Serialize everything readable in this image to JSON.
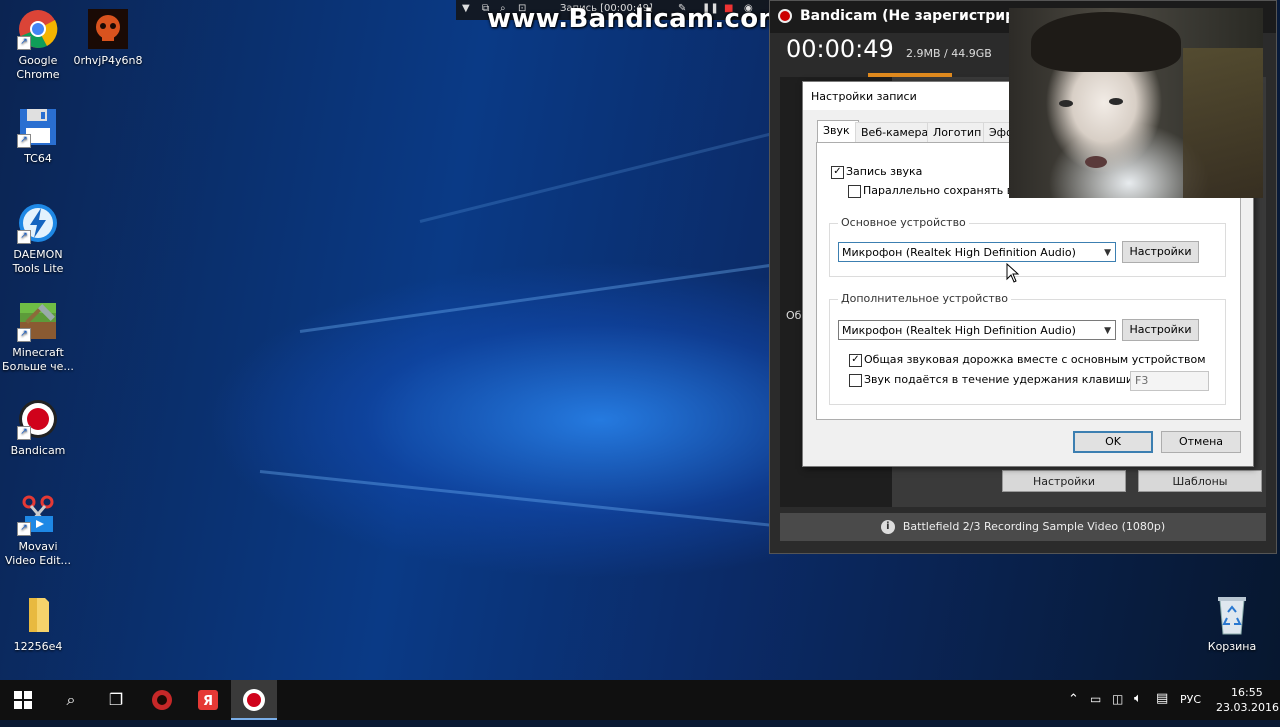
{
  "desktop": {
    "icons": [
      {
        "label": "Google\nChrome",
        "icon": "chrome-icon"
      },
      {
        "label": "0rhvjP4y6n8",
        "icon": "skull-icon"
      },
      {
        "label": "TC64",
        "icon": "floppy-icon"
      },
      {
        "label": "DAEMON\nTools Lite",
        "icon": "lightning-icon"
      },
      {
        "label": "Minecraft\nБольше че...",
        "icon": "minecraft-icon"
      },
      {
        "label": "Bandicam",
        "icon": "record-icon"
      },
      {
        "label": "Movavi\nVideo Edit...",
        "icon": "scissors-icon"
      },
      {
        "label": "12256e4",
        "icon": "folder-icon"
      },
      {
        "label": "Корзина",
        "icon": "recycle-bin-icon"
      }
    ]
  },
  "recording_bar": {
    "text": "Запись [00:00:49]"
  },
  "watermark": "www.Bandicam.com",
  "bandicam": {
    "title": "Bandicam (Не зарегистрир",
    "timer": "00:00:49",
    "size": "2.9MB / 44.9GB",
    "side_label": "Об",
    "settings_button": "Настройки",
    "templates_button": "Шаблоны",
    "footer": "Battlefield 2/3 Recording Sample Video (1080p)"
  },
  "dialog": {
    "title": "Настройки записи",
    "tabs": [
      "Звук",
      "Веб-камера",
      "Логотип",
      "Эфф"
    ],
    "record_audio": {
      "label": "Запись звука",
      "checked": true
    },
    "save_parallel": {
      "label": "Параллельно сохранять в н",
      "checked": false
    },
    "primary_group": {
      "title": "Основное устройство",
      "device": "Микрофон (Realtek High Definition Audio)",
      "settings_button": "Настройки"
    },
    "secondary_group": {
      "title": "Дополнительное устройство",
      "device": "Микрофон (Realtek High Definition Audio)",
      "settings_button": "Настройки",
      "mix_track": {
        "label": "Общая звуковая дорожка вместе с основным устройством",
        "checked": true
      },
      "hold_key": {
        "label": "Звук подаётся в течение удержания клавиши",
        "checked": false
      },
      "hotkey": "F3"
    },
    "ok_button": "OK",
    "cancel_button": "Отмена"
  },
  "taskbar": {
    "language": "РУС",
    "time": "16:55",
    "date": "23.03.2016"
  }
}
